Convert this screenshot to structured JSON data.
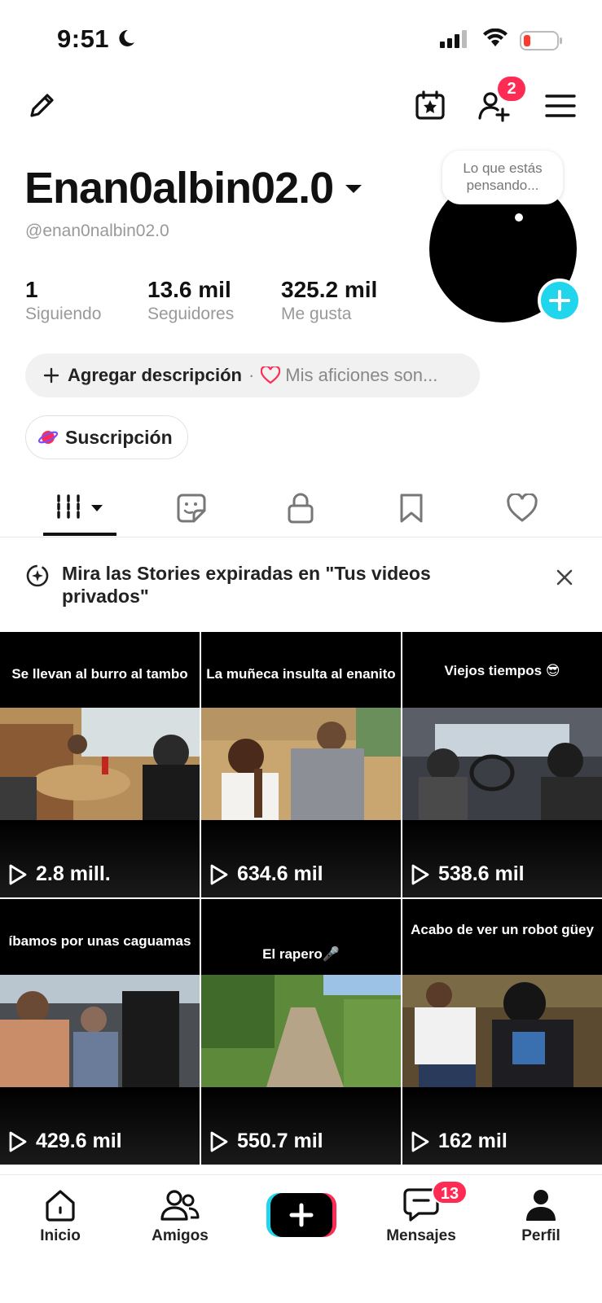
{
  "status_bar": {
    "time": "9:51"
  },
  "top_nav": {
    "friend_requests_badge": "2"
  },
  "profile": {
    "display_name": "Enan0albin02.0",
    "handle": "@enan0nalbin02.0",
    "thought_bubble": "Lo que estás pensando...",
    "stats": [
      {
        "value": "1",
        "label": "Siguiendo"
      },
      {
        "value": "13.6 mil",
        "label": "Seguidores"
      },
      {
        "value": "325.2 mil",
        "label": "Me gusta"
      }
    ],
    "add_description": "Agregar descripción",
    "hobbies_prompt": "Mis aficiones son...",
    "subscription_label": "Suscripción"
  },
  "tabs": [
    "videos",
    "stickers",
    "private",
    "saved",
    "liked"
  ],
  "banner": {
    "text": "Mira las Stories expiradas en \"Tus videos privados\""
  },
  "videos": [
    {
      "caption": "Se llevan al burro al tambo",
      "views": "2.8 mill."
    },
    {
      "caption": "La muñeca insulta al enanito",
      "views": "634.6 mil"
    },
    {
      "caption": "Viejos tiempos 😎",
      "views": "538.6 mil"
    },
    {
      "caption": "íbamos por unas caguamas",
      "views": "429.6 mil"
    },
    {
      "caption": "El rapero🎤",
      "views": "550.7 mil"
    },
    {
      "caption": "Acabo de ver un robot güey",
      "views": "162 mil"
    }
  ],
  "bottom_nav": {
    "home": "Inicio",
    "friends": "Amigos",
    "messages": "Mensajes",
    "messages_badge": "13",
    "profile": "Perfil"
  },
  "colors": {
    "accent_red": "#fe2c55",
    "accent_cyan": "#20d5ec"
  }
}
